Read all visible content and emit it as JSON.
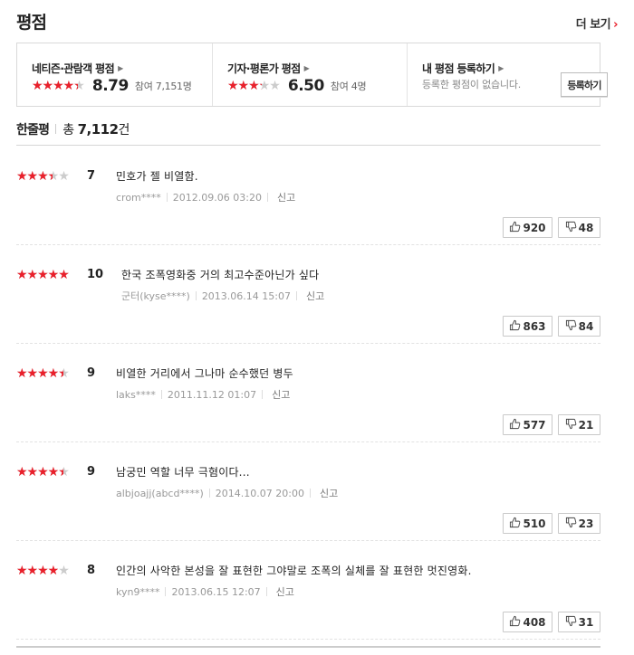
{
  "header": {
    "title": "평점",
    "more_label": "더 보기",
    "more_arrow": "›"
  },
  "score_box": {
    "audience": {
      "label": "네티즌·관람객 평점",
      "score": "8.79",
      "participants": "참여 7,151명",
      "star_fill": 0.879
    },
    "critic": {
      "label": "기자·평론가 평점",
      "score": "6.50",
      "participants": "참여 4명",
      "star_fill": 0.65
    },
    "mine": {
      "label": "내 평점 등록하기",
      "description": "등록한 평점이 없습니다.",
      "button_label": "등록하기"
    }
  },
  "section": {
    "title": "한줄평",
    "total_prefix": "총",
    "total_count": "7,112",
    "total_suffix": "건"
  },
  "reviews": [
    {
      "score": "7",
      "star_fill": 0.7,
      "text": "민호가 젤 비열함.",
      "user": "crom****",
      "date": "2012.09.06 03:20",
      "report": "신고",
      "likes": "920",
      "dislikes": "48"
    },
    {
      "score": "10",
      "star_fill": 1.0,
      "text": "한국 조폭영화중 거의 최고수준아닌가 싶다",
      "user": "군터(kyse****)",
      "date": "2013.06.14 15:07",
      "report": "신고",
      "likes": "863",
      "dislikes": "84"
    },
    {
      "score": "9",
      "star_fill": 0.9,
      "text": "비열한 거리에서 그나마 순수했던 병두",
      "user": "laks****",
      "date": "2011.11.12 01:07",
      "report": "신고",
      "likes": "577",
      "dislikes": "21"
    },
    {
      "score": "9",
      "star_fill": 0.9,
      "text": "남궁민 역할 너무 극혐이다...",
      "user": "albjoajj(abcd****)",
      "date": "2014.10.07 20:00",
      "report": "신고",
      "likes": "510",
      "dislikes": "23"
    },
    {
      "score": "8",
      "star_fill": 0.8,
      "text": "인간의 사악한 본성을 잘 표현한 그야말로 조폭의 실체를 잘 표현한 멋진영화.",
      "user": "kyn9****",
      "date": "2013.06.15 12:07",
      "report": "신고",
      "likes": "408",
      "dislikes": "31"
    }
  ],
  "colors": {
    "star": "#e9202b",
    "star_empty": "#cccccc",
    "accent": "#e9202b"
  },
  "icons": {
    "like": "thumbs-up-icon",
    "dislike": "thumbs-down-icon",
    "caret": "caret-right-icon"
  }
}
